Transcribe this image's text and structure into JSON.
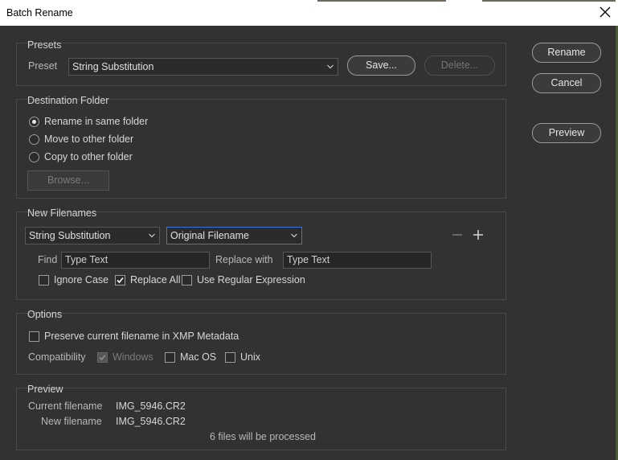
{
  "window": {
    "title": "Batch Rename"
  },
  "buttons": {
    "rename": "Rename",
    "cancel": "Cancel",
    "preview": "Preview"
  },
  "presets": {
    "section_title": "Presets",
    "label": "Preset",
    "selected": "String Substitution",
    "save": "Save...",
    "delete": "Delete..."
  },
  "destination": {
    "section_title": "Destination Folder",
    "options": [
      "Rename in same folder",
      "Move to other folder",
      "Copy to other folder"
    ],
    "selected_index": 0,
    "browse": "Browse..."
  },
  "new_filenames": {
    "section_title": "New Filenames",
    "type_select": "String Substitution",
    "source_select": "Original Filename",
    "find_label": "Find",
    "find_value": "Type Text",
    "replace_label": "Replace with",
    "replace_value": "Type Text",
    "ignore_case": {
      "label": "Ignore Case",
      "checked": false
    },
    "replace_all": {
      "label": "Replace All",
      "checked": true
    },
    "regex": {
      "label": "Use Regular Expression",
      "checked": false
    }
  },
  "options": {
    "section_title": "Options",
    "preserve": {
      "label": "Preserve current filename in XMP Metadata",
      "checked": false
    },
    "compat_label": "Compatibility",
    "windows": {
      "label": "Windows",
      "checked": true,
      "disabled": true
    },
    "macos": {
      "label": "Mac OS",
      "checked": false
    },
    "unix": {
      "label": "Unix",
      "checked": false
    }
  },
  "preview": {
    "section_title": "Preview",
    "current_label": "Current filename",
    "current_value": "IMG_5946.CR2",
    "new_label": "New filename",
    "new_value": "IMG_5946.CR2",
    "summary": "6 files will be processed"
  },
  "colors": {
    "background": "#323232",
    "accent": "#3a76d6"
  }
}
